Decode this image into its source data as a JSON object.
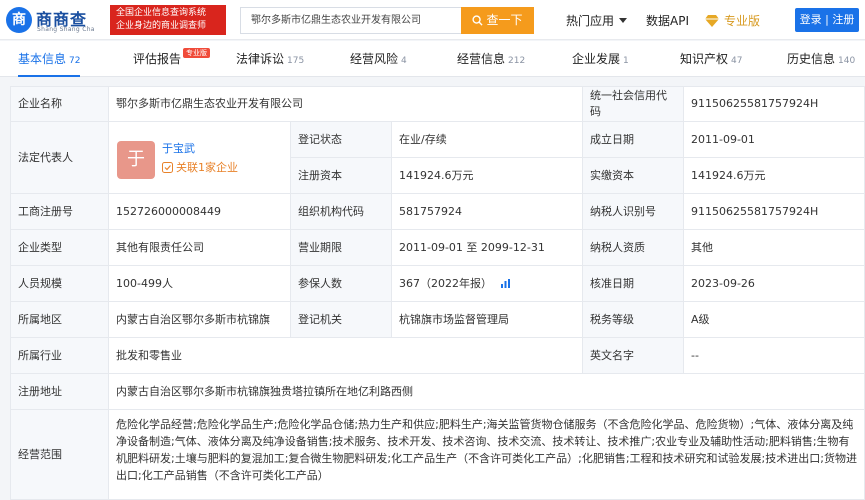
{
  "header": {
    "logo_name": "商商查",
    "logo_sub": "Shang Shang Cha",
    "logo_mark": "商",
    "promo_line1": "全国企业信息查询系统",
    "promo_line2": "企业身边的商业调查师",
    "search_value": "鄂尔多斯市亿鼎生态农业开发有限公司",
    "search_button": "查一下",
    "nav_hot": "热门应用",
    "nav_api": "数据API",
    "nav_pro": "专业版",
    "login": "登录 | 注册"
  },
  "tabs": [
    {
      "label": "基本信息",
      "count": "72",
      "active": true
    },
    {
      "label": "评估报告",
      "count": "",
      "badge": "专业版"
    },
    {
      "label": "法律诉讼",
      "count": "175"
    },
    {
      "label": "经营风险",
      "count": "4"
    },
    {
      "label": "经营信息",
      "count": "212"
    },
    {
      "label": "企业发展",
      "count": "1"
    },
    {
      "label": "知识产权",
      "count": "47"
    },
    {
      "label": "历史信息",
      "count": "140"
    }
  ],
  "info": {
    "company_name_label": "企业名称",
    "company_name": "鄂尔多斯市亿鼎生态农业开发有限公司",
    "credit_code_label": "统一社会信用代码",
    "credit_code": "91150625581757924H",
    "legal_rep_label": "法定代表人",
    "legal_rep_avatar": "于",
    "legal_rep_name": "于宝武",
    "legal_rep_related": "关联1家企业",
    "reg_status_label": "登记状态",
    "reg_status": "在业/存续",
    "founded_label": "成立日期",
    "founded": "2011-09-01",
    "reg_capital_label": "注册资本",
    "reg_capital": "141924.6万元",
    "paid_capital_label": "实缴资本",
    "paid_capital": "141924.6万元",
    "biz_reg_no_label": "工商注册号",
    "biz_reg_no": "152726000008449",
    "org_code_label": "组织机构代码",
    "org_code": "581757924",
    "taxpayer_id_label": "纳税人识别号",
    "taxpayer_id": "91150625581757924H",
    "company_type_label": "企业类型",
    "company_type": "其他有限责任公司",
    "biz_term_label": "营业期限",
    "biz_term": "2011-09-01 至 2099-12-31",
    "taxpayer_qual_label": "纳税人资质",
    "taxpayer_qual": "其他",
    "staff_label": "人员规模",
    "staff": "100-499人",
    "insured_label": "参保人数",
    "insured": "367（2022年报）",
    "approve_date_label": "核准日期",
    "approve_date": "2023-09-26",
    "region_label": "所属地区",
    "region": "内蒙古自治区鄂尔多斯市杭锦旗",
    "reg_authority_label": "登记机关",
    "reg_authority": "杭锦旗市场监督管理局",
    "tax_grade_label": "税务等级",
    "tax_grade": "A级",
    "industry_label": "所属行业",
    "industry": "批发和零售业",
    "english_name_label": "英文名字",
    "english_name": "--",
    "address_label": "注册地址",
    "address": "内蒙古自治区鄂尔多斯市杭锦旗独贵塔拉镇所在地亿利路西侧",
    "scope_label": "经营范围",
    "scope": "危险化学品经营;危险化学品生产;危险化学品仓储;热力生产和供应;肥料生产;海关监管货物仓储服务（不含危险化学品、危险货物）;气体、液体分离及纯净设备制造;气体、液体分离及纯净设备销售;技术服务、技术开发、技术咨询、技术交流、技术转让、技术推广;农业专业及辅助性活动;肥料销售;生物有机肥料研发;土壤与肥料的复混加工;复合微生物肥料研发;化工产品生产（不含许可类化工产品）;化肥销售;工程和技术研究和试验发展;技术进出口;货物进出口;化工产品销售（不含许可类化工产品）"
  },
  "colors": {
    "brand_blue": "#1a72e8",
    "search_orange": "#f59b1c",
    "promo_red": "#d9251d",
    "pro_gold": "#d89b22",
    "avatar_bg": "#e8978a"
  }
}
